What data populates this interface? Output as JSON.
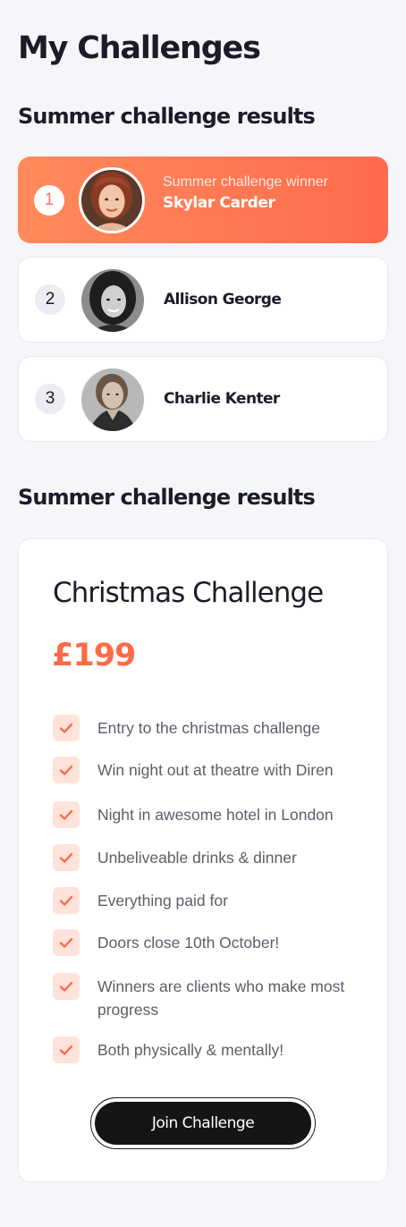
{
  "page": {
    "title": "My Challenges"
  },
  "results_section": {
    "title": "Summer challenge results",
    "winner": {
      "rank": "1",
      "subtitle": "Summer challenge winner",
      "name": "Skylar Carder"
    },
    "entries": [
      {
        "rank": "2",
        "name": "Allison George"
      },
      {
        "rank": "3",
        "name": "Charlie Kenter"
      }
    ]
  },
  "pricing_section": {
    "title": "Summer challenge results",
    "plan": {
      "title": "Christmas Challenge",
      "price": "£199",
      "features": [
        "Entry to the christmas challenge",
        "Win night out at theatre with Diren",
        "Night in awesome hotel in London",
        "Unbeliveable drinks & dinner",
        "Everything paid for",
        "Doors close 10th October!",
        "Winners are clients who make most progress",
        "Both physically & mentally!"
      ],
      "cta_label": "Join Challenge"
    }
  },
  "colors": {
    "accent": "#ff6a48",
    "winner_gradient_start": "#ff8a5a",
    "winner_gradient_end": "#ff6b4d",
    "check_bg": "#ffe3da",
    "button_bg": "#151515",
    "page_bg": "#f5f6fa"
  },
  "icons": {
    "check": "check-icon"
  }
}
